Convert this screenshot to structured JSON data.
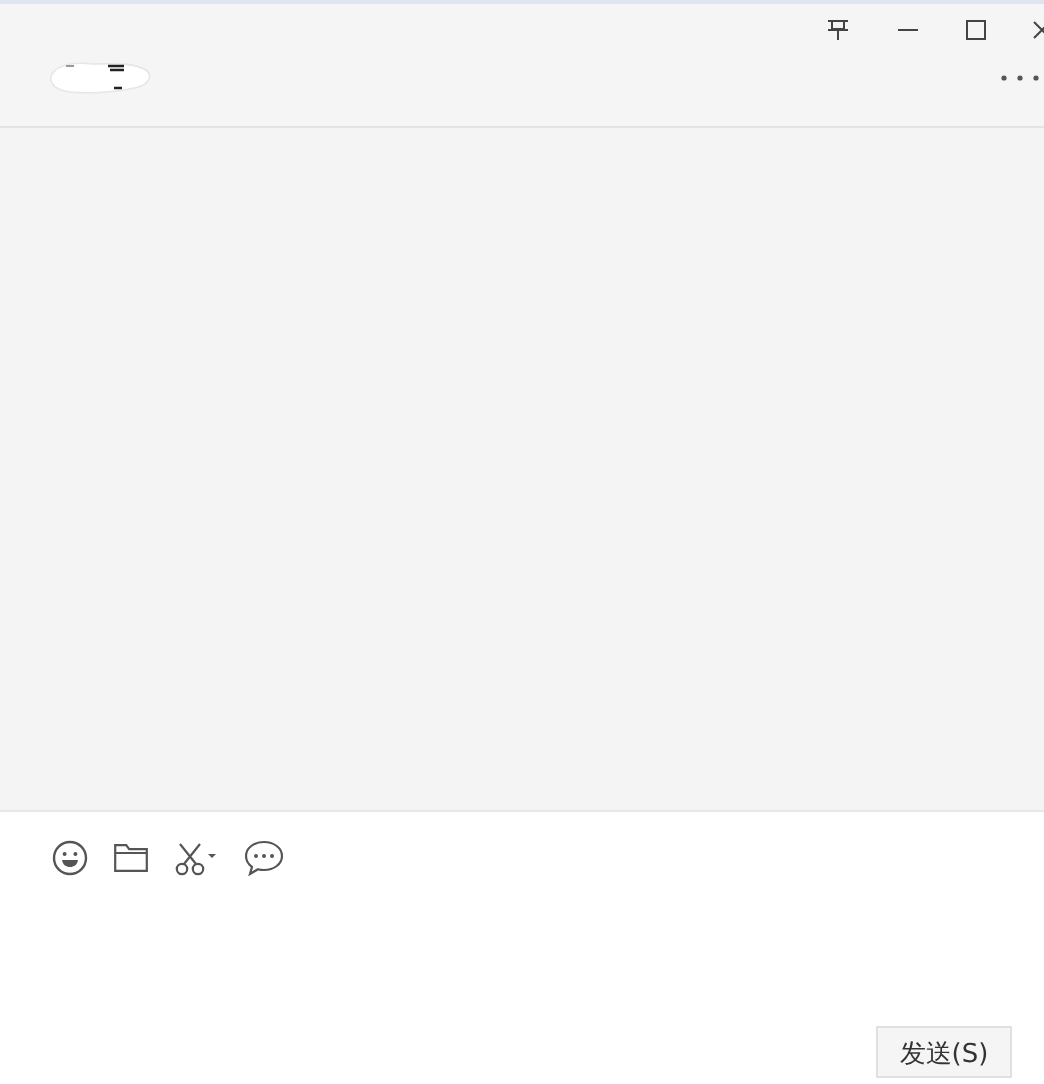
{
  "chat": {
    "title_hidden": true
  },
  "composer": {
    "send_button": {
      "label": "发送(S)"
    }
  }
}
